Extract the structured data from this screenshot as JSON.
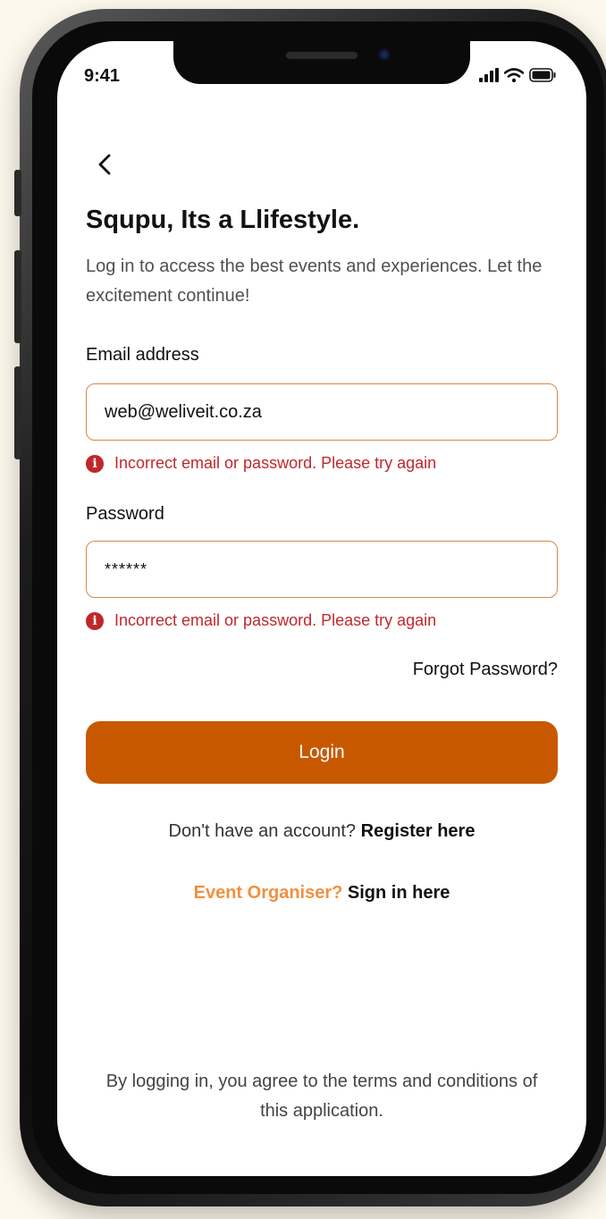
{
  "status_bar": {
    "time": "9:41"
  },
  "header": {
    "title": "Squpu, Its a Llifestyle.",
    "subtitle": "Log in to access the best events and experiences. Let the excitement continue!"
  },
  "form": {
    "email_label": "Email address",
    "email_value": "web@weliveit.co.za",
    "email_error": "Incorrect email or password. Please try again",
    "password_label": "Password",
    "password_value": "******",
    "password_error": "Incorrect email or password. Please try again",
    "forgot_password": "Forgot Password?",
    "login_button": "Login"
  },
  "register": {
    "prompt": "Don't have an account?",
    "link": "Register here"
  },
  "organiser": {
    "prompt": "Event Organiser?",
    "link": "Sign in here"
  },
  "terms": "By logging in, you agree to the terms and conditions of this application.",
  "colors": {
    "primary": "#c85800",
    "accent": "#f0913f",
    "error": "#c0272d",
    "input_border": "#d9884b"
  },
  "icons": [
    "back-arrow-icon",
    "signal-icon",
    "wifi-icon",
    "battery-icon",
    "error-icon"
  ]
}
